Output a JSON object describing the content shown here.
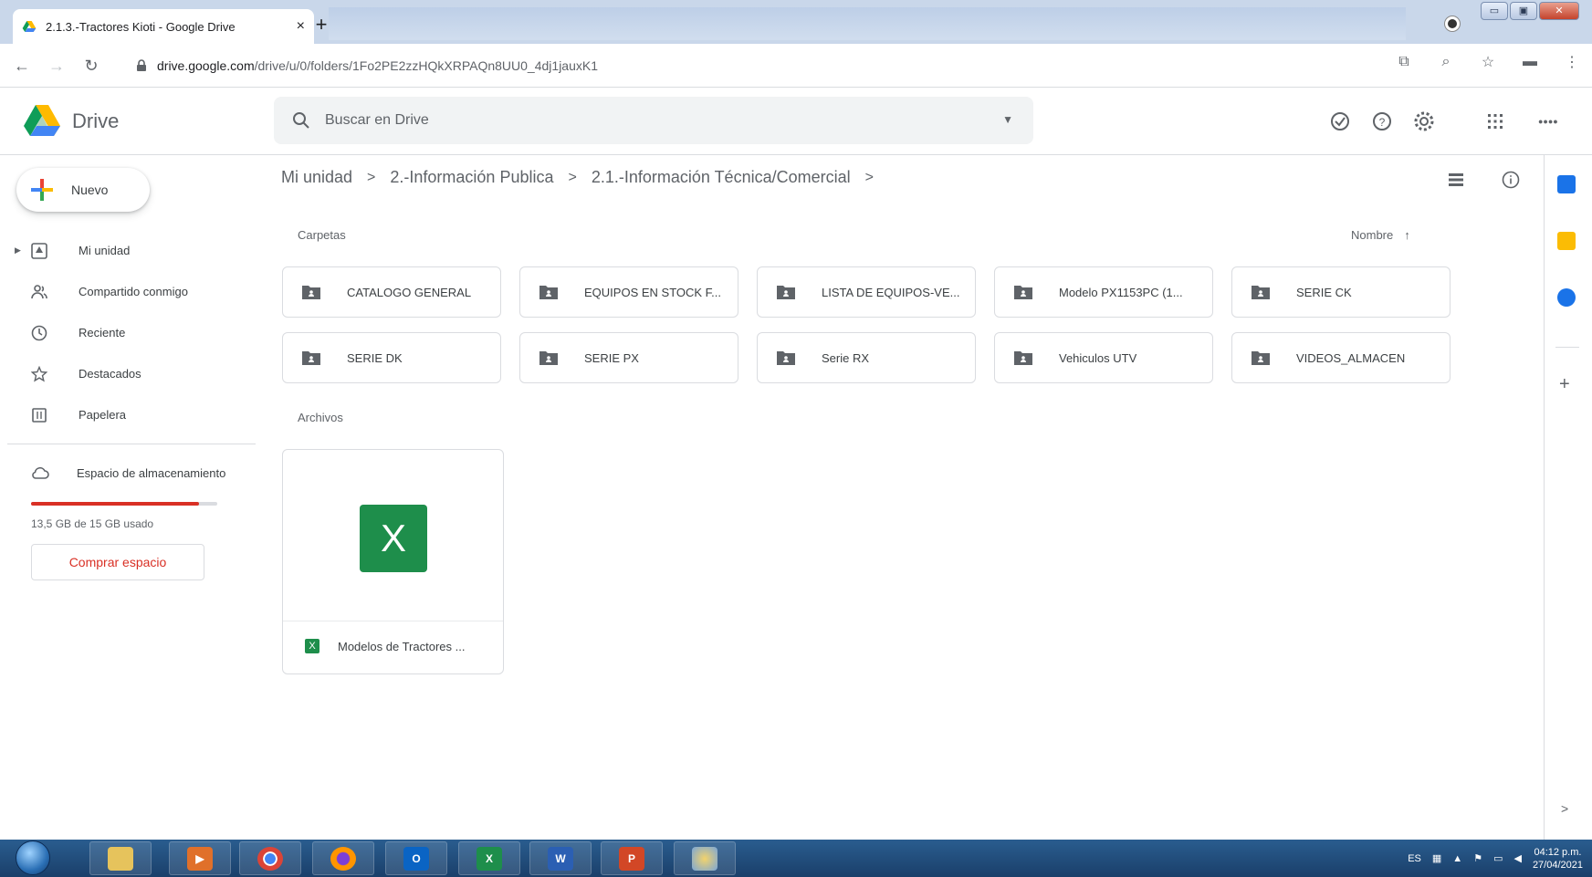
{
  "browser": {
    "tab_title": "2.1.3.-Tractores Kioti - Google Drive",
    "tab_close": "×",
    "new_tab": "+",
    "url_host": "drive.google.com",
    "url_path": "/drive/u/0/folders/1Fo2PE2zzHQkXRPAQn8UU0_4dj1jauxK1",
    "window_controls": {
      "minimize": "▭",
      "maximize": "▣",
      "close": "✕"
    }
  },
  "drive": {
    "brand": "Drive",
    "search_placeholder": "Buscar en Drive",
    "new_button": "Nuevo"
  },
  "sidebar": {
    "items": [
      {
        "label": "Mi unidad",
        "icon": "my-drive-icon"
      },
      {
        "label": "Compartido conmigo",
        "icon": "shared-icon"
      },
      {
        "label": "Reciente",
        "icon": "clock-icon"
      },
      {
        "label": "Destacados",
        "icon": "star-icon"
      },
      {
        "label": "Papelera",
        "icon": "trash-icon"
      }
    ],
    "storage_label": "Espacio de almacenamiento",
    "storage_used_text": "13,5 GB de 15 GB usado",
    "storage_fraction": 0.9,
    "buy_button": "Comprar espacio"
  },
  "breadcrumb": {
    "items": [
      "Mi unidad",
      "2.-Información Publica",
      "2.1.-Información Técnica/Comercial"
    ],
    "separator": ">"
  },
  "main": {
    "folders_title": "Carpetas",
    "files_title": "Archivos",
    "sort_label": "Nombre",
    "sort_arrow": "↑",
    "folders": [
      "CATALOGO GENERAL",
      "EQUIPOS EN STOCK F...",
      "LISTA DE EQUIPOS-VE...",
      "Modelo PX1153PC (1...",
      "SERIE CK",
      "SERIE DK",
      "SERIE PX",
      "Serie RX",
      "Vehiculos UTV",
      "VIDEOS_ALMACEN"
    ],
    "files": [
      {
        "name": "Modelos de Tractores ...",
        "type_letter": "X"
      }
    ]
  },
  "side_panel": {
    "add": "+",
    "expand": ">"
  },
  "taskbar": {
    "lang": "ES",
    "time": "04:12 p.m.",
    "date": "27/04/2021"
  },
  "colors": {
    "accent_red": "#d93025",
    "excel_green": "#1e8e4b",
    "text": "#3c4043",
    "muted": "#5f6368"
  }
}
